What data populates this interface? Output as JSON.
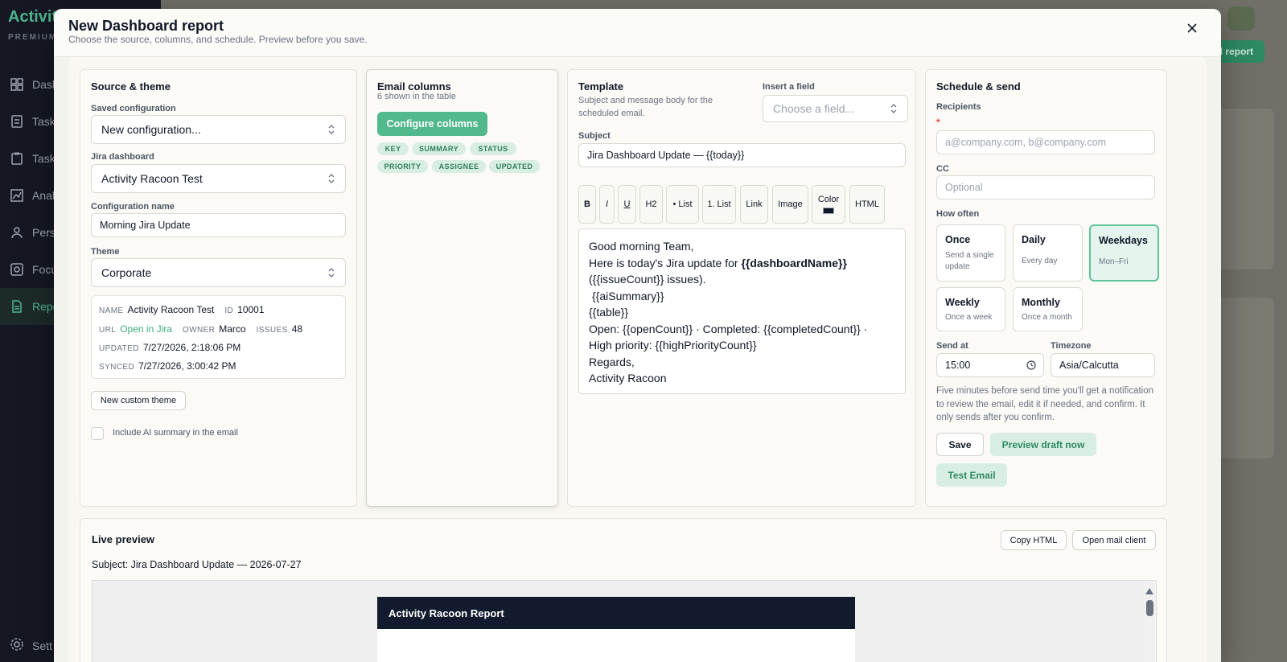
{
  "app": {
    "brand": "Activit",
    "brand_sub": "PREMIUM",
    "nav": [
      "Dash",
      "Task",
      "Task",
      "Anal",
      "Pers",
      "Focu",
      "Repo"
    ],
    "settings": "Sett",
    "new_report": "l report"
  },
  "modal": {
    "title": "New Dashboard report",
    "subtitle": "Choose the source, columns, and schedule. Preview before you save."
  },
  "source": {
    "title": "Source & theme",
    "saved_config_label": "Saved configuration",
    "saved_config_value": "New configuration...",
    "jira_dashboard_label": "Jira dashboard",
    "jira_dashboard_value": "Activity Racoon Test",
    "config_name_label": "Configuration name",
    "config_name_value": "Morning Jira Update",
    "theme_label": "Theme",
    "theme_value": "Corporate",
    "info": {
      "name_key": "NAME",
      "name_value": "Activity Racoon Test",
      "id_key": "ID",
      "id_value": "10001",
      "url_key": "URL",
      "url_value": "Open in Jira",
      "owner_key": "OWNER",
      "owner_value": "Marco",
      "issues_key": "ISSUES",
      "issues_value": "48",
      "updated_key": "UPDATED",
      "updated_value": "7/27/2026, 2:18:06 PM",
      "synced_key": "SYNCED",
      "synced_value": "7/27/2026, 3:00:42 PM"
    },
    "new_theme_button": "New custom theme",
    "ai_summary_label": "Include AI summary in the email"
  },
  "columns": {
    "title": "Email columns",
    "subtitle": "6 shown in the table",
    "configure_button": "Configure columns",
    "chips": [
      "KEY",
      "SUMMARY",
      "STATUS",
      "PRIORITY",
      "ASSIGNEE",
      "UPDATED"
    ]
  },
  "template": {
    "title": "Template",
    "subtitle_line1": "Subject and message body for the",
    "subtitle_line2": "scheduled email.",
    "insert_label": "Insert a field",
    "insert_placeholder": "Choose a field...",
    "subject_label": "Subject",
    "subject_value": "Jira Dashboard Update — {{today}}",
    "toolbar": {
      "bold": "B",
      "italic": "I",
      "underline": "U",
      "h2": "H2",
      "bullet": "• List",
      "numbered": "1. List",
      "link": "Link",
      "image": "Image",
      "color": "Color",
      "html": "HTML"
    },
    "color_swatch": "#0f172a",
    "body": {
      "line1": "Good morning Team,",
      "line2_prefix": "Here is today's Jira update for ",
      "line2_bold": "{{dashboardName}}",
      "line3": "({{issueCount}} issues).",
      "line4": "{{aiSummary}}",
      "line5": "{{table}}",
      "line6": "Open: {{openCount}} · Completed: {{completedCount}} ·",
      "line7": "High priority: {{highPriorityCount}}",
      "line8": "Regards,",
      "line9": "Activity Racoon"
    }
  },
  "schedule": {
    "title": "Schedule & send",
    "recipients_label": "Recipients",
    "required_mark": "*",
    "recipients_placeholder": "a@company.com, b@company.com",
    "cc_label": "CC",
    "cc_placeholder": "Optional",
    "how_often_label": "How often",
    "options": [
      {
        "title": "Once",
        "desc": "Send a single update"
      },
      {
        "title": "Daily",
        "desc": "Every day"
      },
      {
        "title": "Weekdays",
        "desc": "Mon–Fri"
      },
      {
        "title": "Weekly",
        "desc": "Once a week"
      },
      {
        "title": "Monthly",
        "desc": "Once a month"
      }
    ],
    "selected": "Weekdays",
    "send_at_label": "Send at",
    "send_at_value": "15:00",
    "timezone_label": "Timezone",
    "timezone_value": "Asia/Calcutta",
    "note": "Five minutes before send time you'll get a notification to review the email, edit it if needed, and confirm. It only sends after you confirm.",
    "save_button": "Save",
    "preview_button": "Preview draft now",
    "test_button": "Test Email"
  },
  "preview": {
    "title": "Live preview",
    "copy_html": "Copy HTML",
    "open_mail": "Open mail client",
    "subject": "Subject: Jira Dashboard Update — 2026-07-27",
    "email_header": "Activity Racoon Report"
  },
  "colors": {
    "accent": "#52b98c",
    "accent_light": "#d8eee3",
    "email_header": "#121b2e"
  }
}
